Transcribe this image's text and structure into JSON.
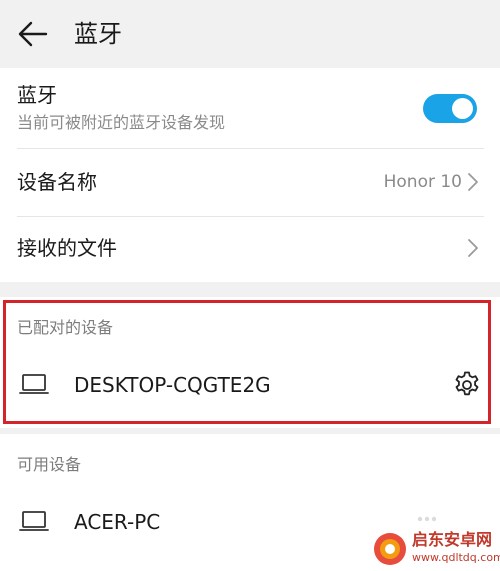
{
  "header": {
    "title": "蓝牙",
    "back_icon": "arrow-left-icon"
  },
  "bluetooth": {
    "title": "蓝牙",
    "subtitle": "当前可被附近的蓝牙设备发现",
    "enabled": true,
    "accent_color": "#1aa3e6"
  },
  "device_name": {
    "label": "设备名称",
    "value": "Honor 10"
  },
  "received_files": {
    "label": "接收的文件"
  },
  "paired_section": {
    "header": "已配对的设备",
    "devices": [
      {
        "name": "DESKTOP-CQGTE2G",
        "icon": "laptop-icon",
        "action_icon": "gear-icon"
      }
    ],
    "highlight_color": "#d4242a"
  },
  "available_section": {
    "header": "可用设备",
    "devices": [
      {
        "name": "ACER-PC",
        "icon": "laptop-icon"
      }
    ]
  },
  "watermark": {
    "text": "启东安卓网",
    "url": "www.qdltdq.com"
  }
}
